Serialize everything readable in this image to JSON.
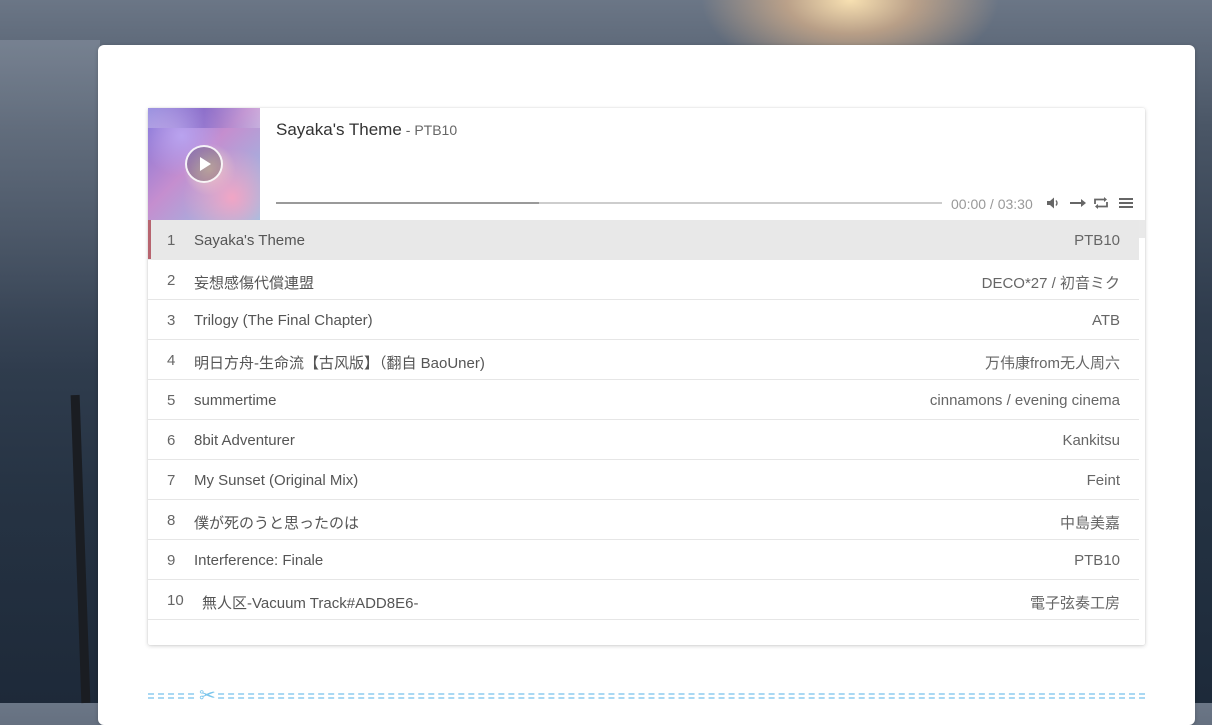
{
  "player": {
    "title": "Sayaka's Theme",
    "author": "- PTB10",
    "time": "00:00 / 03:30",
    "progress_loaded": 0.395,
    "playlist_accent": "#b7646f"
  },
  "playlist": [
    {
      "index": "1",
      "title": "Sayaka's Theme",
      "artist": "PTB10"
    },
    {
      "index": "2",
      "title": "妄想感傷代償連盟",
      "artist": "DECO*27 / 初音ミク"
    },
    {
      "index": "3",
      "title": "Trilogy (The Final Chapter)",
      "artist": "ATB"
    },
    {
      "index": "4",
      "title": "明日方舟-生命流【古风版】（翻自 BaoUner)",
      "artist": "万伟康from无人周六"
    },
    {
      "index": "5",
      "title": "summertime",
      "artist": "cinnamons / evening cinema"
    },
    {
      "index": "6",
      "title": "8bit Adventurer",
      "artist": "Kankitsu"
    },
    {
      "index": "7",
      "title": "My Sunset (Original Mix)",
      "artist": "Feint"
    },
    {
      "index": "8",
      "title": "僕が死のうと思ったのは",
      "artist": "中島美嘉"
    },
    {
      "index": "9",
      "title": "Interference: Finale",
      "artist": "PTB10"
    },
    {
      "index": "10",
      "title": "無人区-Vacuum Track#ADD8E6-",
      "artist": "電子弦奏工房"
    }
  ],
  "icons": {
    "play": "play-icon",
    "volume": "volume-icon",
    "order": "order-list-icon",
    "loop": "loop-icon",
    "menu": "menu-icon",
    "divider": "scissors-icon"
  },
  "divider": {
    "glyph": "✂"
  }
}
